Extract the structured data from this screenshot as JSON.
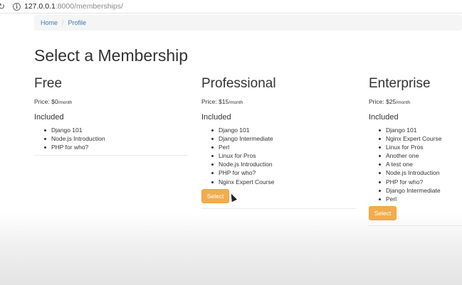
{
  "browser": {
    "url_host": "127.0.0.1",
    "url_rest": ":8000/memberships/",
    "reload_icon": "reload-icon",
    "info_icon": "info-icon"
  },
  "breadcrumb": {
    "home": "Home",
    "separator": "/",
    "profile": "Profile"
  },
  "page": {
    "title": "Select a Membership"
  },
  "plans": [
    {
      "name": "Free",
      "price_label": "Price: $0",
      "price_unit": "/month",
      "included_label": "Included",
      "features": [
        "Django 101",
        "Node.js Introduction",
        "PHP for who?"
      ]
    },
    {
      "name": "Professional",
      "price_label": "Price: $15",
      "price_unit": "/month",
      "included_label": "Included",
      "features": [
        "Django 101",
        "Django Intermediate",
        "Perl",
        "Linux for Pros",
        "Node.js Introduction",
        "PHP for who?",
        "Nginx Expert Course"
      ],
      "button_label": "Select"
    },
    {
      "name": "Enterprise",
      "price_label": "Price: $25",
      "price_unit": "/month",
      "included_label": "Included",
      "features": [
        "Django 101",
        "Nginx Expert Course",
        "Linux for Pros",
        "Another one",
        "A test one",
        "Node.js Introduction",
        "PHP for who?",
        "Django Intermediate",
        "Perl"
      ],
      "button_label": "Select"
    }
  ],
  "colors": {
    "link": "#337ab7",
    "button": "#f0ad4e",
    "breadcrumb_bg": "#f5f5f5"
  }
}
